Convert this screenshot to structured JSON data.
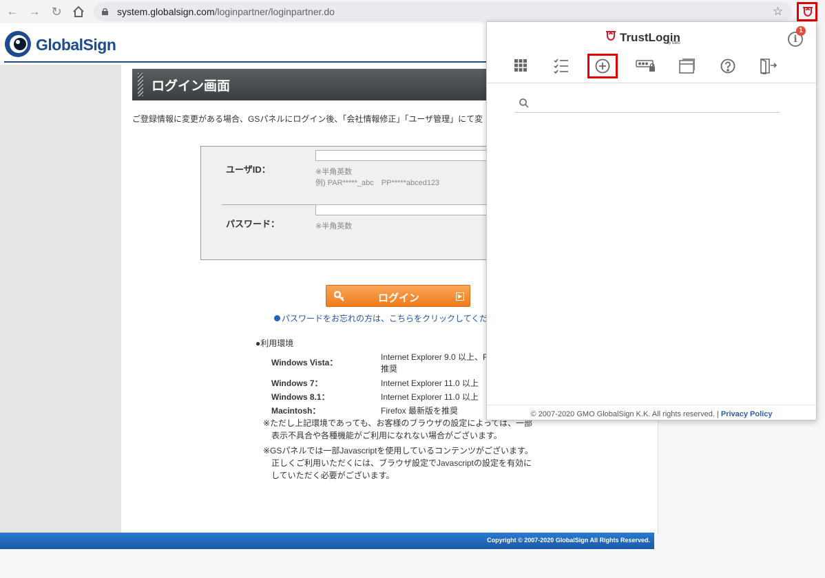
{
  "browser": {
    "url_host": "system.globalsign.com",
    "url_path": "/loginpartner/loginpartner.do"
  },
  "page": {
    "logo_text": "GlobalSign",
    "title": "ログイン画面",
    "notice": "ご登録情報に変更がある場合、GSパネルにログイン後、「会社情報修正」「ユーザ管理」にて変",
    "form": {
      "user_id_label": "ユーザID：",
      "user_id_value": "",
      "user_id_hint1": "※半角英数",
      "user_id_hint2": "例) PAR*****_abc　PP*****abced123",
      "password_label": "パスワード：",
      "password_value": "",
      "password_hint": "※半角英数"
    },
    "login_button": "ログイン",
    "forgot_link": "パスワードをお忘れの方は、こちらをクリックしてくだ",
    "env": {
      "title": "●利用環境",
      "rows": [
        {
          "os": "Windows Vista：",
          "browser": "Internet Explorer 9.0 以上、F",
          "browser2": "推奨"
        },
        {
          "os": "Windows 7：",
          "browser": "Internet Explorer 11.0 以上"
        },
        {
          "os": "Windows 8.1：",
          "browser": "Internet Explorer 11.0 以上"
        },
        {
          "os": "Macintosh：",
          "browser": "Firefox 最新版を推奨"
        }
      ],
      "note1_line1": "※ただし上記環境であっても、お客様のブラウザの設定によっては、一部",
      "note1_line2": "　表示不具合や各種機能がご利用になれない場合がございます。",
      "note2_line1": "※GSパネルでは一部Javascriptを使用しているコンテンツがございます。",
      "note2_line2": "　正しくご利用いただくには、ブラウザ設定でJavascriptの設定を有効に",
      "note2_line3": "　していただく必要がございます。"
    },
    "copyright": "Copyright © 2007-2020 GlobalSign All Rights Reserved."
  },
  "popup": {
    "brand": "TrustLogin",
    "brand_sub": "by GMO",
    "info_badge_count": "1",
    "toolbar": [
      {
        "name": "apps-grid-icon"
      },
      {
        "name": "checklist-icon"
      },
      {
        "name": "add-circle-icon",
        "selected": true
      },
      {
        "name": "password-card-icon"
      },
      {
        "name": "window-icon"
      },
      {
        "name": "help-icon"
      },
      {
        "name": "logout-icon"
      }
    ],
    "search_value": "",
    "footer_copyright": "© 2007-2020 GMO GlobalSign K.K. All rights reserved. | ",
    "footer_link": "Privacy Policy"
  },
  "colors": {
    "accent_red": "#e00000",
    "brand_blue": "#1d4c8c",
    "login_orange": "#f07c1c"
  }
}
